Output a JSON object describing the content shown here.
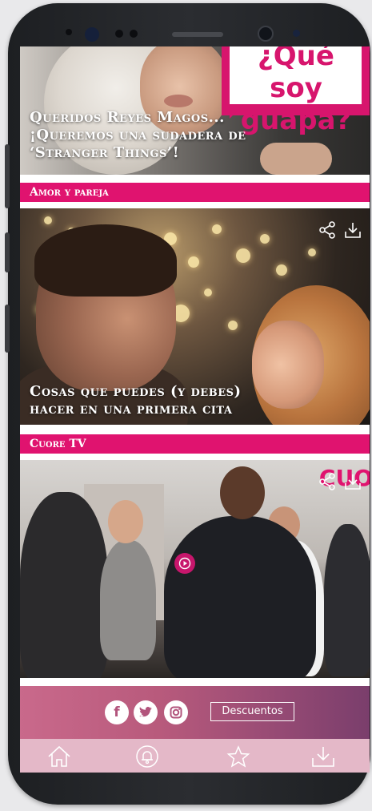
{
  "articles": [
    {
      "title": "Queridos Reyes Magos... ¡Queremos una sudadera de ‘Stranger Things’!",
      "bubble_text": "¿Qué soy guapa?"
    },
    {
      "category": "Amor y pareja",
      "title": "Cosas que puedes (y debes) hacer en una primera cita"
    },
    {
      "category": "Cuore TV",
      "brand_mark": "CUO"
    }
  ],
  "footer": {
    "social": [
      {
        "name": "facebook-icon",
        "glyph": "f"
      },
      {
        "name": "twitter-icon",
        "glyph": "🐦"
      },
      {
        "name": "instagram-icon",
        "glyph": "◎"
      }
    ],
    "discount_label": "Descuentos"
  },
  "tabbar": {
    "items": [
      {
        "name": "home-icon"
      },
      {
        "name": "bell-icon"
      },
      {
        "name": "star-icon"
      },
      {
        "name": "download-icon"
      }
    ]
  },
  "colors": {
    "accent": "#e0136f",
    "footer_start": "#c9698b",
    "footer_end": "#7a3e6c",
    "tabbar_bg": "#e4b8c8"
  }
}
